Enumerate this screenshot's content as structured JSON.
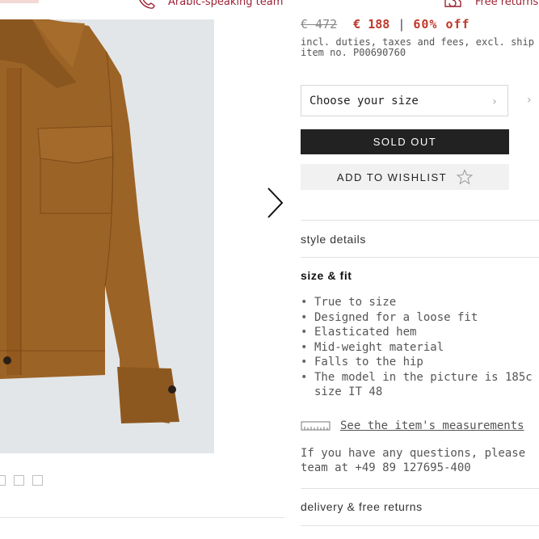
{
  "header": {
    "arabic_label": "Arabic-speaking team",
    "returns_label": "Free returns"
  },
  "product": {
    "old_price": "€ 472",
    "new_price": "€ 188",
    "separator": "|",
    "discount": "60% off",
    "duties_note": "incl. duties, taxes and fees, excl. ship",
    "item_no": "item no. P00690760"
  },
  "size_select": {
    "placeholder": "Choose your size"
  },
  "buttons": {
    "sold_out": "SOLD OUT",
    "wishlist": "ADD TO WISHLIST"
  },
  "sections": {
    "style_details": "style details",
    "size_fit": "size & fit",
    "delivery": "delivery & free returns"
  },
  "size_fit_items": [
    "True to size",
    "Designed for a loose fit",
    "Elasticated hem",
    "Mid-weight material",
    "Falls to the hip",
    "The model in the picture is 185c",
    "size IT 48"
  ],
  "measurements_link": "See the item's measurements",
  "questions": {
    "line1": "If you have any questions, please",
    "line2": "team at +49 89 127695-400"
  },
  "colors": {
    "accent_red": "#c0392b",
    "header_text": "#9b2335",
    "button_dark": "#222222",
    "jacket": "#9c6326"
  },
  "icons": [
    "phone-icon",
    "returns-icon",
    "chevron-right-icon",
    "star-icon",
    "ruler-icon"
  ]
}
